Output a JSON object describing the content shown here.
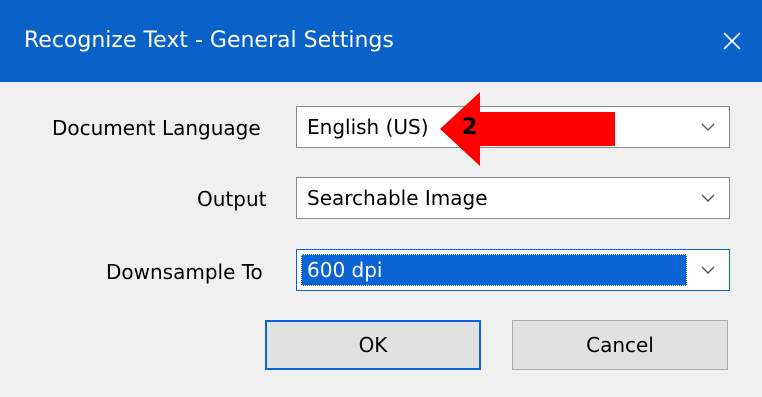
{
  "dialog": {
    "title": "Recognize Text - General Settings"
  },
  "fields": {
    "document_language": {
      "label": "Document Language",
      "value": "English (US)"
    },
    "output": {
      "label": "Output",
      "value": "Searchable Image"
    },
    "downsample": {
      "label": "Downsample To",
      "value": "600 dpi"
    }
  },
  "buttons": {
    "ok_label": "OK",
    "cancel_label": "Cancel"
  },
  "annotation": {
    "step_number": "2"
  },
  "colors": {
    "titlebar": "#0a61c7",
    "selection": "#0a64d6",
    "annotation_arrow": "#ff0000",
    "dialog_body": "#f0f0f0"
  },
  "icons": {
    "close": "close-icon",
    "dropdown": "chevron-down-icon"
  }
}
